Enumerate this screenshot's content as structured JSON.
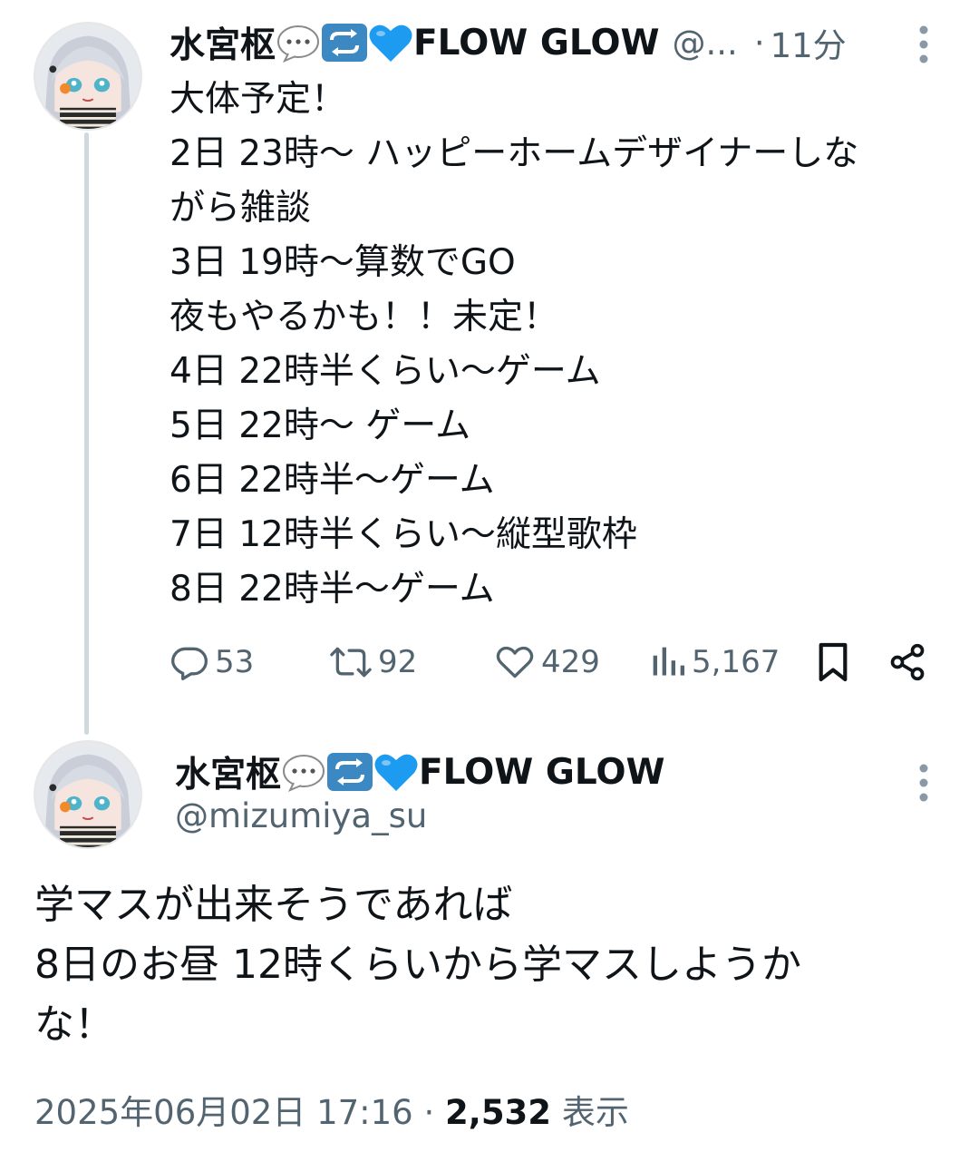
{
  "reply_tweet": {
    "author": {
      "display_name": "水宮枢",
      "name_suffix": "FLOW GLOW",
      "handle_truncated": "@...",
      "emoji_icons": [
        "speech-bubble-icon",
        "repeat-icon",
        "blue-heart-icon"
      ]
    },
    "separator": "·",
    "time": "11分",
    "body_lines": [
      "大体予定！",
      "2日 23時〜 ハッピーホームデザイナーしな",
      "がら雑談",
      "3日 19時〜算数でGO",
      "夜もやるかも！！未定！",
      "4日 22時半くらい〜ゲーム",
      "5日 22時〜 ゲーム",
      "6日 22時半〜ゲーム",
      "7日 12時半くらい〜縦型歌枠",
      "8日 22時半〜ゲーム"
    ],
    "actions": {
      "replies": "53",
      "reposts": "92",
      "likes": "429",
      "views": "5,167"
    }
  },
  "main_tweet": {
    "author": {
      "display_name": "水宮枢",
      "name_suffix": "FLOW GLOW",
      "handle": "@mizumiya_su"
    },
    "body_lines": [
      "学マスが出来そうであれば",
      "8日のお昼 12時くらいから学マスしようか",
      "な！"
    ],
    "timestamp": "2025年06月02日 17:16",
    "separator": "·",
    "view_count": "2,532",
    "view_label": "表示"
  },
  "colors": {
    "text_primary": "#0f1419",
    "text_secondary": "#536471",
    "thread_line": "#cfd9de",
    "blue_heart": "#1d9bf0",
    "repeat_badge": "#3b88c3"
  }
}
